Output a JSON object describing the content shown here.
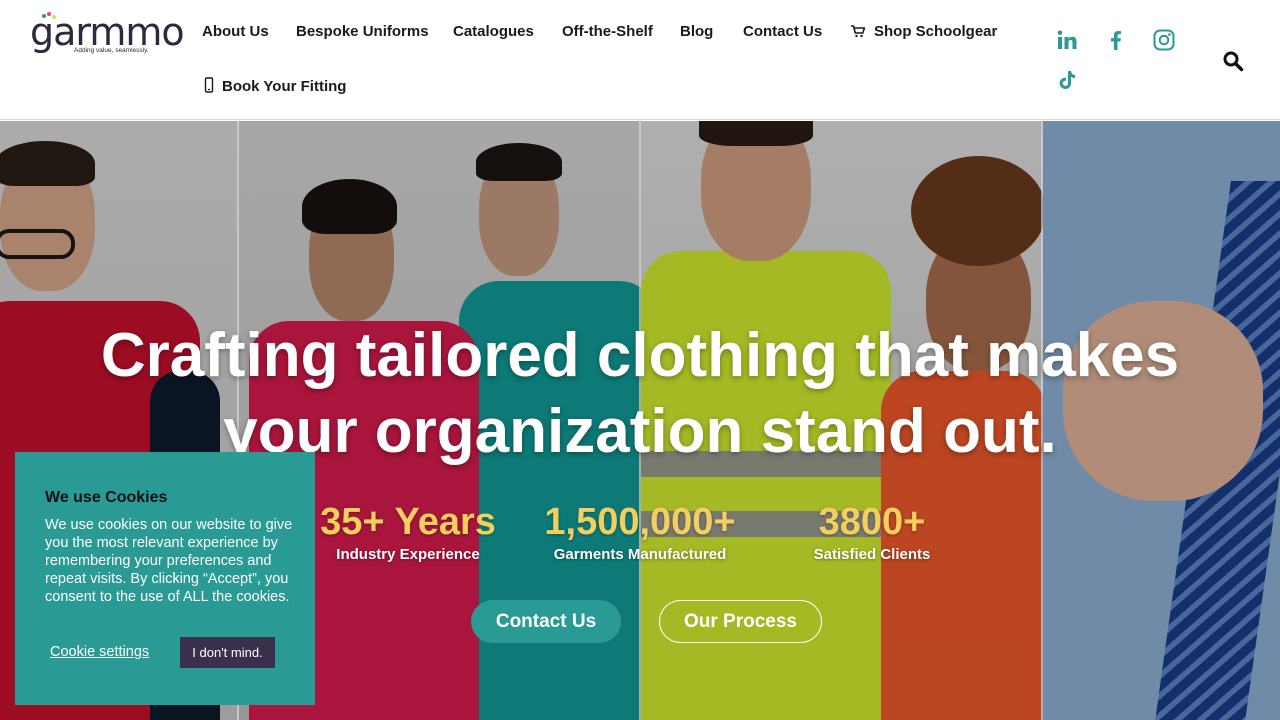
{
  "brand": {
    "name": "garmmo",
    "tagline": "Adding value, seamlessly."
  },
  "nav": {
    "about": "About Us",
    "bespoke": "Bespoke Uniforms",
    "catalogues": "Catalogues",
    "off_the_shelf": "Off-the-Shelf",
    "blog": "Blog",
    "contact": "Contact Us",
    "shop": "Shop Schoolgear",
    "fitting": "Book Your Fitting"
  },
  "social": {
    "icons": [
      "linkedin-icon",
      "facebook-icon",
      "instagram-icon",
      "tiktok-icon"
    ],
    "color": "#2a9a94"
  },
  "hero": {
    "title_line1": "Crafting tailored clothing that makes",
    "title_line2": "your organization stand out.",
    "stats": [
      {
        "value": "35+ Years",
        "label": "Industry Experience"
      },
      {
        "value": "1,500,000+",
        "label": "Garments Manufactured"
      },
      {
        "value": "3800+",
        "label": "Satisfied Clients"
      }
    ],
    "primary_button": "Contact Us",
    "secondary_button": "Our Process"
  },
  "cookie": {
    "title": "We use Cookies",
    "text": "We use cookies on our website to give you the most relevant experience by remembering your preferences and repeat visits. By clicking “Accept”, you consent to the use of ALL the cookies.",
    "settings": "Cookie settings",
    "accept": "I don't mind."
  },
  "colors": {
    "accent": "#2a9a94",
    "stat": "#f3cf5e",
    "dark": "#3b2f4e"
  }
}
